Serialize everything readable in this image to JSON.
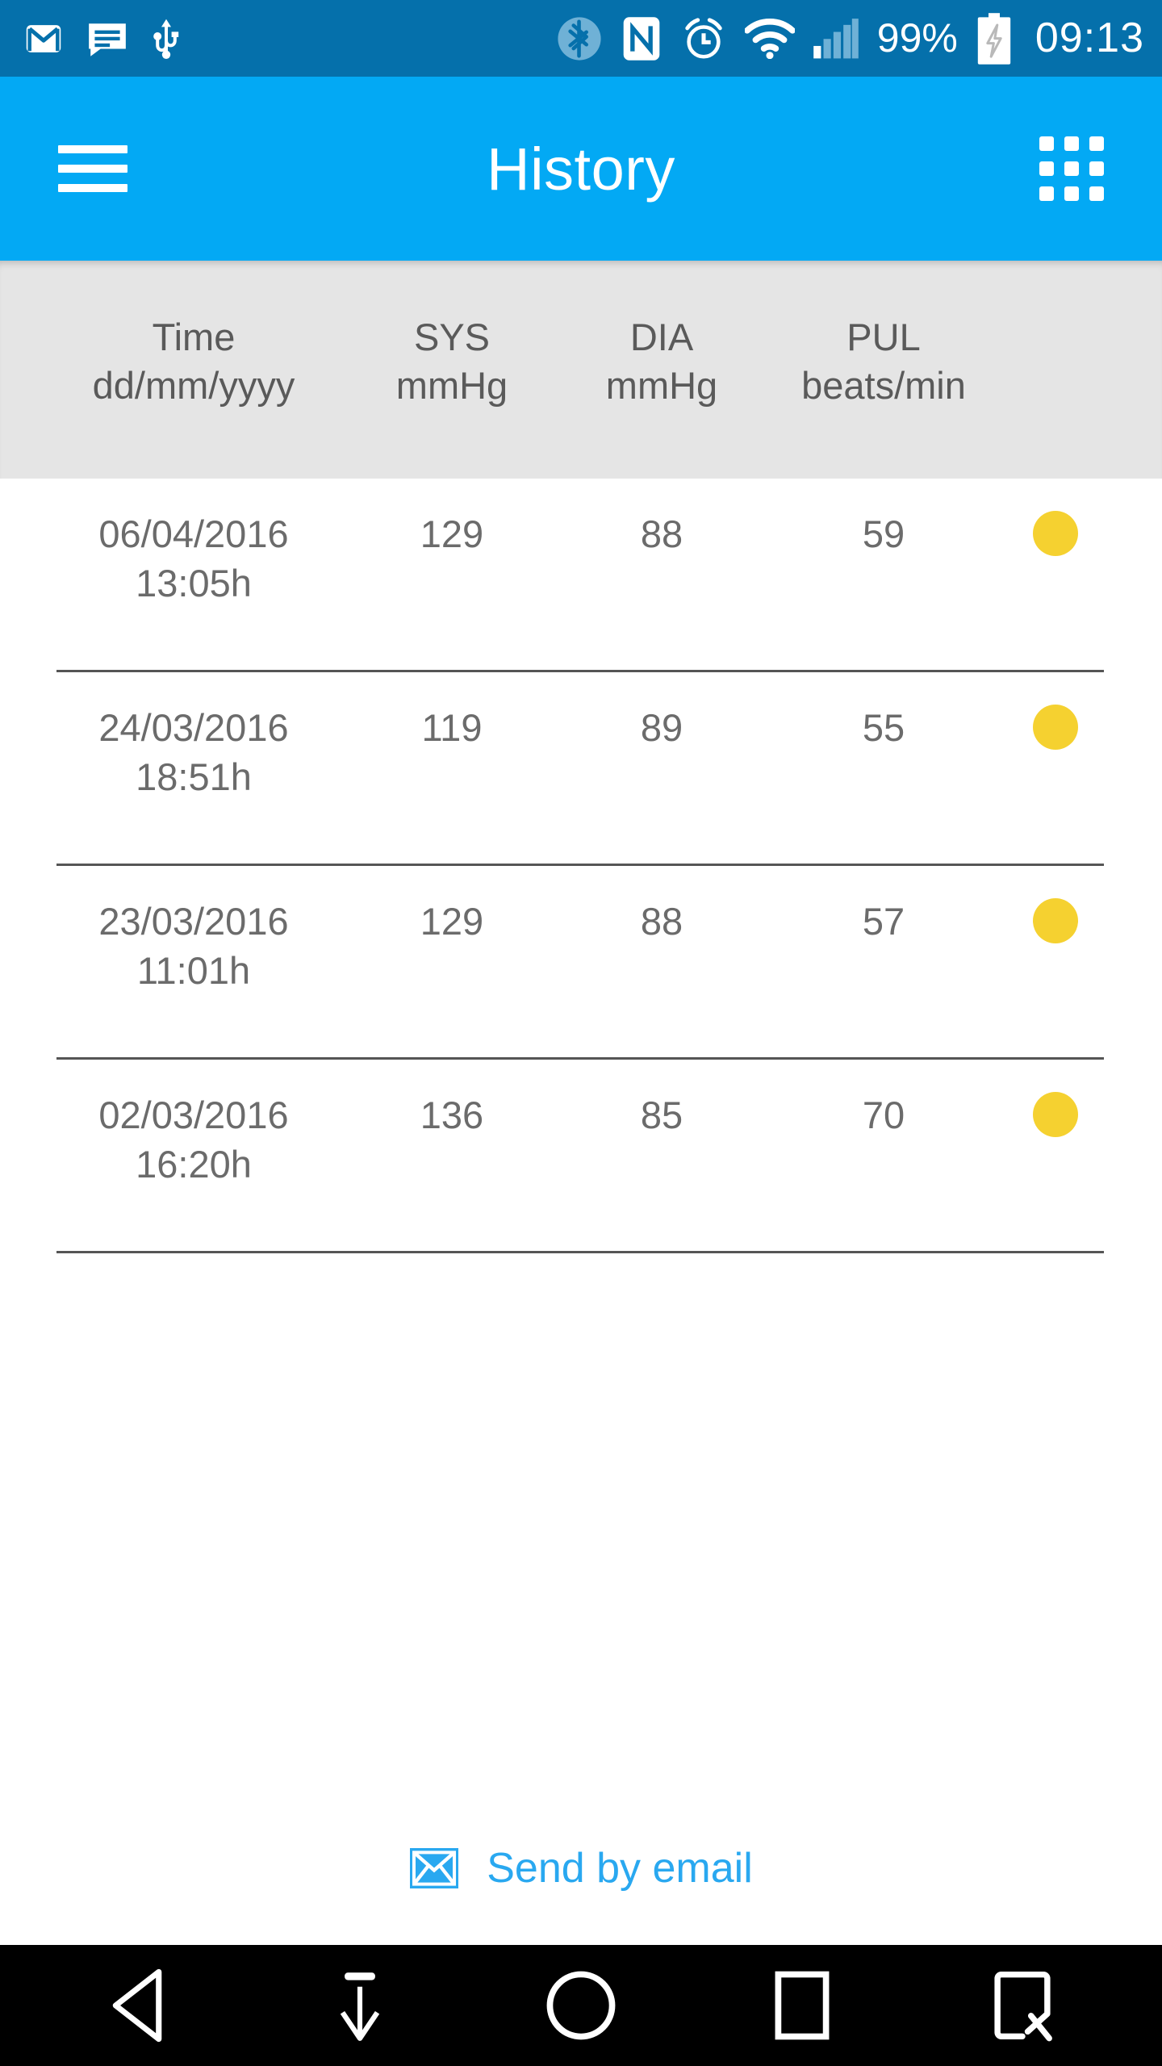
{
  "status_bar": {
    "background": "#0570ab",
    "left_icons": [
      "gmail-icon",
      "sms-message-icon",
      "usb-icon"
    ],
    "right_icons": [
      "bluetooth-icon",
      "nfc-icon",
      "alarm-clock-icon",
      "wifi-icon",
      "cellular-signal-icon"
    ],
    "battery_percent": "99%",
    "battery_state": "charging",
    "clock": "09:13"
  },
  "app_bar": {
    "background": "#03A9F4",
    "menu_icon": "hamburger-menu-icon",
    "title": "History",
    "grid_icon": "apps-grid-icon"
  },
  "table": {
    "header_background": "#E5E5E5",
    "columns": [
      {
        "key": "time",
        "label": "Time",
        "unit": "dd/mm/yyyy"
      },
      {
        "key": "sys",
        "label": "SYS",
        "unit": "mmHg"
      },
      {
        "key": "dia",
        "label": "DIA",
        "unit": "mmHg"
      },
      {
        "key": "pul",
        "label": "PUL",
        "unit": "beats/min"
      }
    ],
    "rows": [
      {
        "date": "06/04/2016",
        "time": "13:05h",
        "sys": "129",
        "dia": "88",
        "pul": "59",
        "indicator_color": "#F5D130"
      },
      {
        "date": "24/03/2016",
        "time": "18:51h",
        "sys": "119",
        "dia": "89",
        "pul": "55",
        "indicator_color": "#F5D130"
      },
      {
        "date": "23/03/2016",
        "time": "11:01h",
        "sys": "129",
        "dia": "88",
        "pul": "57",
        "indicator_color": "#F5D130"
      },
      {
        "date": "02/03/2016",
        "time": "16:20h",
        "sys": "136",
        "dia": "85",
        "pul": "70",
        "indicator_color": "#F5D130"
      }
    ]
  },
  "footer": {
    "send_email_icon": "envelope-icon",
    "send_email_label": "Send by email",
    "accent_color": "#29A8F0"
  },
  "nav_bar": {
    "background": "#000000",
    "buttons": [
      "back-icon",
      "download-icon",
      "home-icon",
      "recents-icon",
      "screenshot-icon"
    ]
  }
}
